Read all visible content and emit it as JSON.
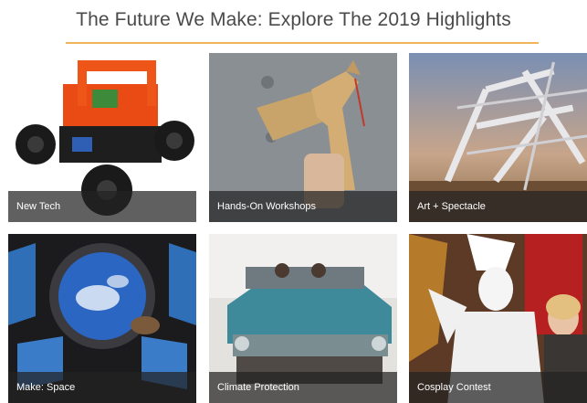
{
  "page": {
    "title": "The Future We Make: Explore The 2019 Highlights",
    "accent": "#f0b45a"
  },
  "tiles": [
    {
      "label": "New Tech",
      "image": "robot-car-image"
    },
    {
      "label": "Hands-On Workshops",
      "image": "cardboard-pegasus-image"
    },
    {
      "label": "Art + Spectacle",
      "image": "metal-sculpture-image"
    },
    {
      "label": "Make: Space",
      "image": "space-station-window-image"
    },
    {
      "label": "Climate Protection",
      "image": "desert-art-car-image"
    },
    {
      "label": "Cosplay Contest",
      "image": "cosplay-costume-image"
    }
  ]
}
